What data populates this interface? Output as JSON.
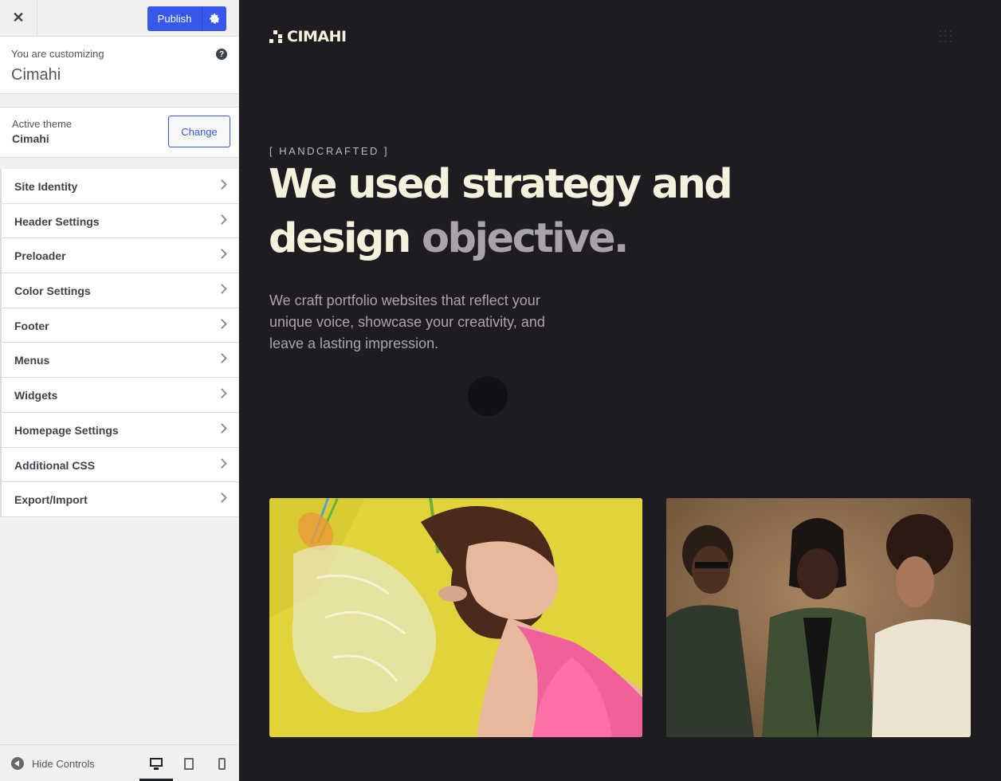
{
  "sidebar": {
    "publish_label": "Publish",
    "customizing_label": "You are customizing",
    "site_name": "Cimahi",
    "theme_label": "Active theme",
    "theme_name": "Cimahi",
    "change_label": "Change",
    "menu_items": [
      {
        "label": "Site Identity"
      },
      {
        "label": "Header Settings"
      },
      {
        "label": "Preloader"
      },
      {
        "label": "Color Settings"
      },
      {
        "label": "Footer"
      },
      {
        "label": "Menus"
      },
      {
        "label": "Widgets"
      },
      {
        "label": "Homepage Settings"
      },
      {
        "label": "Additional CSS"
      },
      {
        "label": "Export/Import"
      }
    ],
    "hide_controls_label": "Hide Controls"
  },
  "preview": {
    "logo_text": "CIMAHI",
    "eyebrow": "[ HANDCRAFTED ]",
    "headline_main": "We used strategy and design",
    "headline_muted": "objective.",
    "lead": "We craft portfolio websites that reflect your unique voice, showcase your creativity, and leave a lasting impression."
  },
  "colors": {
    "accent": "#3858e9",
    "preview_bg": "#1f1c21",
    "headline": "#f4f1dc"
  },
  "icons": [
    "close-icon",
    "gear-icon",
    "help-icon",
    "chevron-right-icon",
    "hide-controls-icon",
    "desktop-icon",
    "tablet-icon",
    "mobile-icon",
    "grid-menu-icon"
  ]
}
